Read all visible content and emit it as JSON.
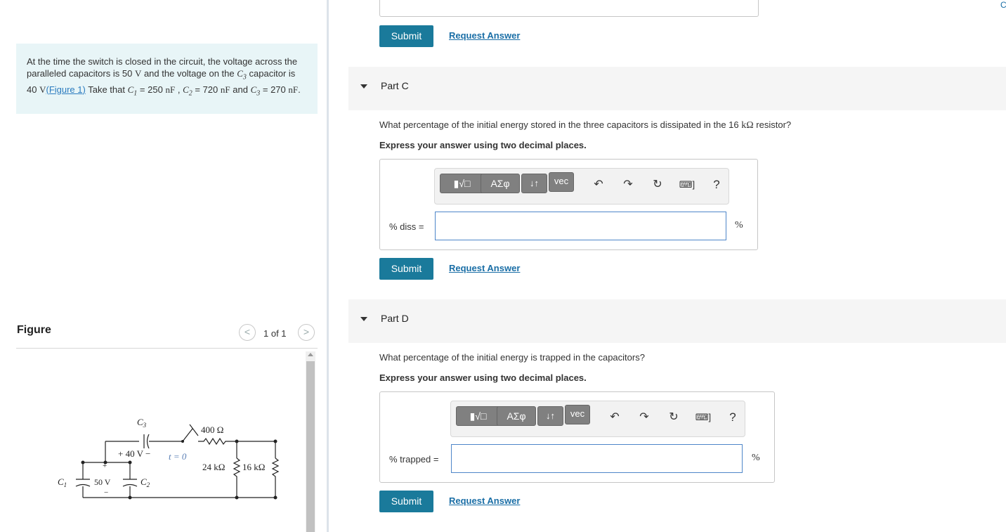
{
  "problem": {
    "pre1": "At the time the switch is closed in the circuit, the voltage across the paralleled capacitors is 50",
    "unit_V": "V",
    "pre2": "and the voltage on the",
    "c3_symbol": "C",
    "c3_sub": "3",
    "pre3": "capacitor is 40",
    "link": "(Figure 1)",
    "pre4": "Take that",
    "c1_symbol": "C",
    "c1_sub": "1",
    "c1_val": "= 250",
    "unit_nF": "nF",
    "comma": ",",
    "c2_symbol": "C",
    "c2_sub": "2",
    "c2_val": "= 720",
    "and": "and",
    "c3_val": "= 270",
    "period": "."
  },
  "figure": {
    "title": "Figure",
    "count": "1 of 1",
    "prev": "<",
    "next": ">",
    "labels": {
      "c3": "C",
      "c3_sub": "3",
      "r400": "400 Ω",
      "v40": "+ 40 V −",
      "switch": "t = 0",
      "plus": "+",
      "minus": "−",
      "c1": "C",
      "c1_sub": "1",
      "v50": "50 V",
      "c2": "C",
      "c2_sub": "2",
      "r24": "24 kΩ",
      "r16": "16 kΩ"
    }
  },
  "parts": [
    {
      "label": "Part C",
      "question_pre": "What percentage of the initial energy stored in the three capacitors is dissipated in the 16",
      "question_unit": "kΩ",
      "question_post": "resistor?",
      "instruction": "Express your answer using two decimal places.",
      "answer_label": "% diss =",
      "unit": "%"
    },
    {
      "label": "Part D",
      "question_pre": "What percentage of the initial energy is trapped in the capacitors?",
      "question_unit": "",
      "question_post": "",
      "instruction": "Express your answer using two decimal places.",
      "answer_label": "% trapped =",
      "unit": "%"
    }
  ],
  "toolbar": {
    "templates": "▮√□",
    "greek": "ΑΣφ",
    "arrows": "↓↑",
    "vec": "vec",
    "undo": "↶",
    "redo": "↷",
    "reset": "↻",
    "keyboard": "⌨]",
    "help": "?"
  },
  "buttons": {
    "submit": "Submit",
    "request": "Request Answer"
  },
  "corner": "C"
}
